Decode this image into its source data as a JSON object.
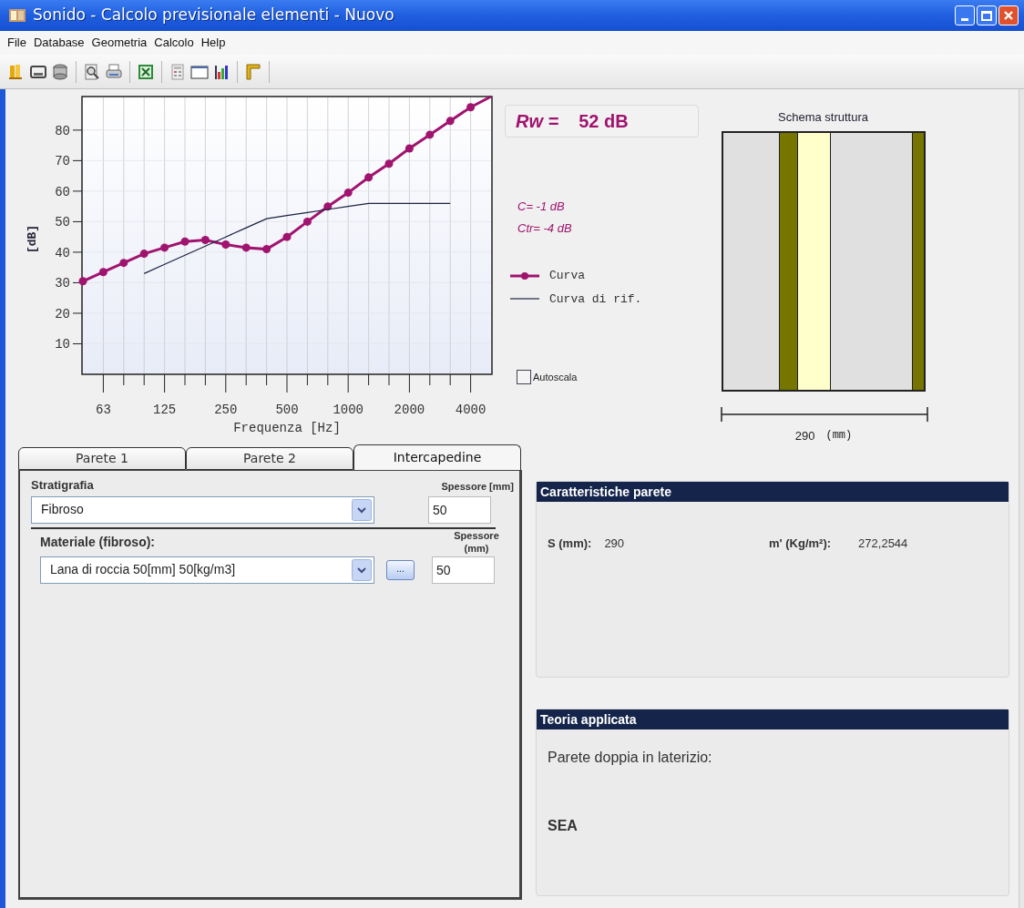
{
  "window": {
    "title": "Sonido - Calcolo previsionale elementi - Nuovo"
  },
  "menu": [
    "File",
    "Database",
    "Geometria",
    "Calcolo",
    "Help"
  ],
  "chart": {
    "chart_data": {
      "type": "line",
      "xlabel": "Frequenza [Hz]",
      "ylabel": "[dB]",
      "categories": [
        null,
        "63",
        null,
        null,
        "125",
        null,
        null,
        "250",
        null,
        null,
        "500",
        null,
        null,
        "1000",
        null,
        null,
        "2000",
        null,
        null,
        "4000",
        null
      ],
      "series": [
        {
          "name": "Curva",
          "color": "#a0146f",
          "marker": "circle",
          "values": [
            30.5,
            33.5,
            36.5,
            39.5,
            41.5,
            43.5,
            44,
            42.5,
            41.5,
            41,
            45,
            50,
            55,
            59.5,
            64.5,
            69,
            74,
            78.5,
            83,
            87.5,
            91
          ]
        },
        {
          "name": "Curva di rif.",
          "color": "#1a2340",
          "values": [
            null,
            null,
            null,
            33,
            36,
            39,
            42,
            45,
            48,
            51,
            52,
            53,
            54,
            55,
            56,
            56,
            56,
            56,
            56,
            null,
            null
          ]
        }
      ],
      "ylim": [
        0,
        91
      ],
      "yticks": [
        10,
        20,
        30,
        40,
        50,
        60,
        70,
        80
      ],
      "grid": true
    }
  },
  "result": {
    "rw_label": "Rw =",
    "rw_value": "52 dB",
    "c": "C= -1 dB",
    "ctr": "Ctr= -4 dB"
  },
  "autoscala": {
    "label": "Autoscala",
    "checked": false
  },
  "structure": {
    "title": "Schema struttura",
    "layers": [
      {
        "color": "#e0e0e0"
      },
      {
        "color": "#757500"
      },
      {
        "color": "#ffffcc"
      },
      {
        "color": "#e0e0e0"
      },
      {
        "color": "#757500"
      }
    ],
    "dimension": "290",
    "unit": "(mm)"
  },
  "tabs": [
    {
      "label": "Parete 1",
      "selected": false
    },
    {
      "label": "Parete 2",
      "selected": false
    },
    {
      "label": "Intercapedine",
      "selected": true
    }
  ],
  "form": {
    "stratigrafia": {
      "label": "Stratigrafia",
      "value": "Fibroso"
    },
    "spessore1": {
      "label": "Spessore [mm]",
      "value": "50"
    },
    "materiale": {
      "label": "Materiale (fibroso):",
      "value": "Lana di roccia 50[mm] 50[kg/m3]"
    },
    "browse_button": "...",
    "spessore2": {
      "label": "Spessore (mm)",
      "value": "50"
    }
  },
  "characteristics": {
    "title": "Caratteristiche parete",
    "fields": [
      {
        "label": "S (mm):",
        "value": "290"
      },
      {
        "label": "m' (Kg/m²):",
        "value": "272,2544"
      }
    ]
  },
  "theory": {
    "title": "Teoria applicata",
    "description": "Parete doppia in laterizio:",
    "method": "SEA"
  }
}
